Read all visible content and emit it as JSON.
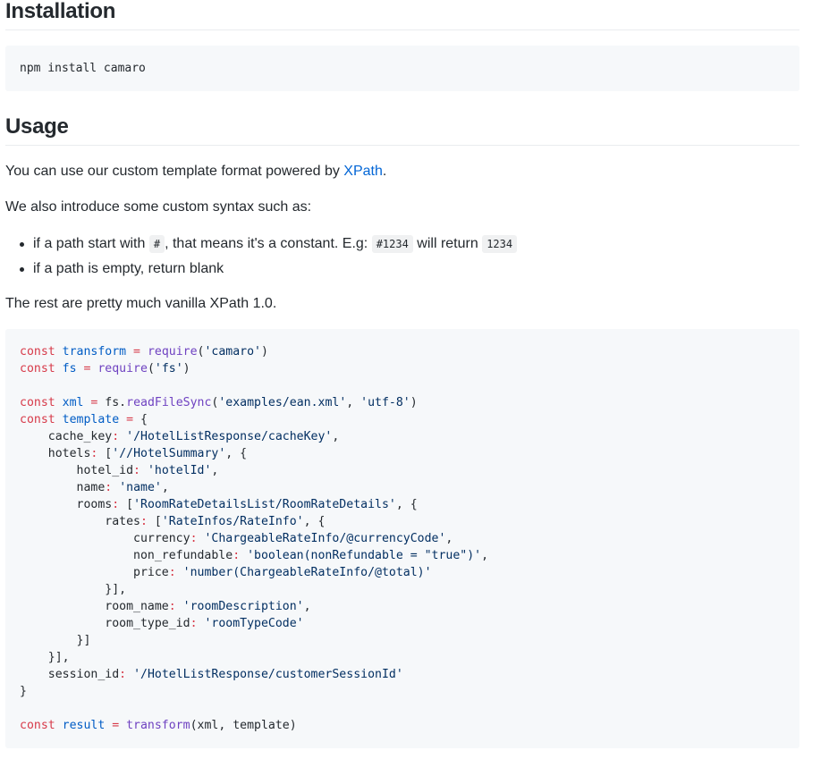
{
  "installation": {
    "heading": "Installation",
    "command": "npm install camaro"
  },
  "usage": {
    "heading": "Usage",
    "intro_before": "You can use our custom template format powered by ",
    "intro_link": "XPath",
    "intro_after": ".",
    "syntax_intro": "We also introduce some custom syntax such as:",
    "bullets": {
      "b1_part1": "if a path start with ",
      "b1_code1": "#",
      "b1_part2": ", that means it's a constant. E.g: ",
      "b1_code2": "#1234",
      "b1_part3": " will return ",
      "b1_code3": "1234",
      "b2": "if a path is empty, return blank"
    },
    "rest_text": "The rest are pretty much vanilla XPath 1.0."
  },
  "colors": {
    "keyword": "#d73a49",
    "function": "#6f42c1",
    "variable": "#005cc5",
    "string": "#032f62",
    "link": "#0366d6",
    "code_bg": "#f6f8fa"
  },
  "code_lines": [
    [
      [
        "kw",
        "const "
      ],
      [
        "vr",
        "transform"
      ],
      [
        "kw",
        " = "
      ],
      [
        "fn",
        "require"
      ],
      [
        "pl",
        "("
      ],
      [
        "st",
        "'camaro'"
      ],
      [
        "pl",
        ")"
      ]
    ],
    [
      [
        "kw",
        "const "
      ],
      [
        "vr",
        "fs"
      ],
      [
        "kw",
        " = "
      ],
      [
        "fn",
        "require"
      ],
      [
        "pl",
        "("
      ],
      [
        "st",
        "'fs'"
      ],
      [
        "pl",
        ")"
      ]
    ],
    [],
    [
      [
        "kw",
        "const "
      ],
      [
        "vr",
        "xml"
      ],
      [
        "kw",
        " = "
      ],
      [
        "pl",
        "fs."
      ],
      [
        "fn",
        "readFileSync"
      ],
      [
        "pl",
        "("
      ],
      [
        "st",
        "'examples/ean.xml'"
      ],
      [
        "pl",
        ", "
      ],
      [
        "st",
        "'utf-8'"
      ],
      [
        "pl",
        ")"
      ]
    ],
    [
      [
        "kw",
        "const "
      ],
      [
        "vr",
        "template"
      ],
      [
        "kw",
        " = "
      ],
      [
        "pl",
        "{"
      ]
    ],
    [
      [
        "pl",
        "    cache_key"
      ],
      [
        "kw",
        ":"
      ],
      [
        "pl",
        " "
      ],
      [
        "st",
        "'/HotelListResponse/cacheKey'"
      ],
      [
        "pl",
        ","
      ]
    ],
    [
      [
        "pl",
        "    hotels"
      ],
      [
        "kw",
        ":"
      ],
      [
        "pl",
        " ["
      ],
      [
        "st",
        "'//HotelSummary'"
      ],
      [
        "pl",
        ", {"
      ]
    ],
    [
      [
        "pl",
        "        hotel_id"
      ],
      [
        "kw",
        ":"
      ],
      [
        "pl",
        " "
      ],
      [
        "st",
        "'hotelId'"
      ],
      [
        "pl",
        ","
      ]
    ],
    [
      [
        "pl",
        "        name"
      ],
      [
        "kw",
        ":"
      ],
      [
        "pl",
        " "
      ],
      [
        "st",
        "'name'"
      ],
      [
        "pl",
        ","
      ]
    ],
    [
      [
        "pl",
        "        rooms"
      ],
      [
        "kw",
        ":"
      ],
      [
        "pl",
        " ["
      ],
      [
        "st",
        "'RoomRateDetailsList/RoomRateDetails'"
      ],
      [
        "pl",
        ", {"
      ]
    ],
    [
      [
        "pl",
        "            rates"
      ],
      [
        "kw",
        ":"
      ],
      [
        "pl",
        " ["
      ],
      [
        "st",
        "'RateInfos/RateInfo'"
      ],
      [
        "pl",
        ", {"
      ]
    ],
    [
      [
        "pl",
        "                currency"
      ],
      [
        "kw",
        ":"
      ],
      [
        "pl",
        " "
      ],
      [
        "st",
        "'ChargeableRateInfo/@currencyCode'"
      ],
      [
        "pl",
        ","
      ]
    ],
    [
      [
        "pl",
        "                non_refundable"
      ],
      [
        "kw",
        ":"
      ],
      [
        "pl",
        " "
      ],
      [
        "st",
        "'boolean(nonRefundable = \"true\")'"
      ],
      [
        "pl",
        ","
      ]
    ],
    [
      [
        "pl",
        "                price"
      ],
      [
        "kw",
        ":"
      ],
      [
        "pl",
        " "
      ],
      [
        "st",
        "'number(ChargeableRateInfo/@total)'"
      ]
    ],
    [
      [
        "pl",
        "            }],"
      ]
    ],
    [
      [
        "pl",
        "            room_name"
      ],
      [
        "kw",
        ":"
      ],
      [
        "pl",
        " "
      ],
      [
        "st",
        "'roomDescription'"
      ],
      [
        "pl",
        ","
      ]
    ],
    [
      [
        "pl",
        "            room_type_id"
      ],
      [
        "kw",
        ":"
      ],
      [
        "pl",
        " "
      ],
      [
        "st",
        "'roomTypeCode'"
      ]
    ],
    [
      [
        "pl",
        "        }]"
      ]
    ],
    [
      [
        "pl",
        "    }],"
      ]
    ],
    [
      [
        "pl",
        "    session_id"
      ],
      [
        "kw",
        ":"
      ],
      [
        "pl",
        " "
      ],
      [
        "st",
        "'/HotelListResponse/customerSessionId'"
      ]
    ],
    [
      [
        "pl",
        "}"
      ]
    ],
    [],
    [
      [
        "kw",
        "const "
      ],
      [
        "vr",
        "result"
      ],
      [
        "kw",
        " = "
      ],
      [
        "fn",
        "transform"
      ],
      [
        "pl",
        "(xml, template)"
      ]
    ]
  ]
}
